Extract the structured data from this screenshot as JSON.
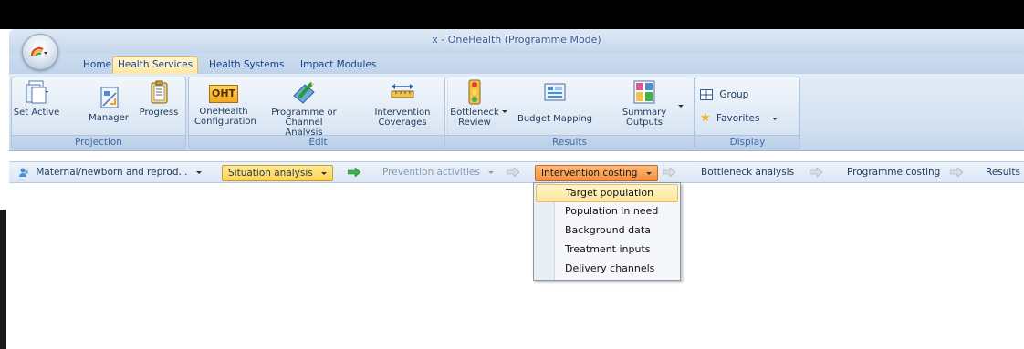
{
  "window": {
    "title": "x - OneHealth (Programme Mode)"
  },
  "tabs": [
    {
      "label": "Home"
    },
    {
      "label": "Health Services"
    },
    {
      "label": "Health Systems"
    },
    {
      "label": "Impact Modules"
    }
  ],
  "ribbon": {
    "projection": {
      "label": "Projection",
      "set_active": "Set Active",
      "manager": "Manager",
      "progress": "Progress"
    },
    "edit": {
      "label": "Edit",
      "onehealth_config_l1": "OneHealth",
      "onehealth_config_l2": "Configuration",
      "oht_text": "OHT",
      "programme_l1": "Programme or",
      "programme_l2": "Channel Analysis",
      "coverages_l1": "Intervention",
      "coverages_l2": "Coverages"
    },
    "results": {
      "label": "Results",
      "bottleneck_l1": "Bottleneck",
      "bottleneck_l2": "Review",
      "budget_mapping": "Budget Mapping",
      "summary_l1": "Summary",
      "summary_l2": "Outputs"
    },
    "display": {
      "label": "Display",
      "group": "Group",
      "favorites": "Favorites"
    }
  },
  "workflow": {
    "module": "Maternal/newborn and reprod...",
    "steps": [
      {
        "label": "Situation analysis"
      },
      {
        "label": "Prevention activities"
      },
      {
        "label": "Intervention costing"
      },
      {
        "label": "Bottleneck analysis"
      },
      {
        "label": "Programme costing"
      },
      {
        "label": "Results"
      }
    ]
  },
  "dropdown_menu": {
    "items": [
      {
        "label": "Target population"
      },
      {
        "label": "Population in need"
      },
      {
        "label": "Background data"
      },
      {
        "label": "Treatment inputs"
      },
      {
        "label": "Delivery channels"
      }
    ]
  },
  "colors": {
    "active_step_situation": "#ffd34f",
    "active_step_costing": "#f4903c",
    "arrow_green": "#3cb44b",
    "arrow_gray": "#b0b8c4"
  }
}
